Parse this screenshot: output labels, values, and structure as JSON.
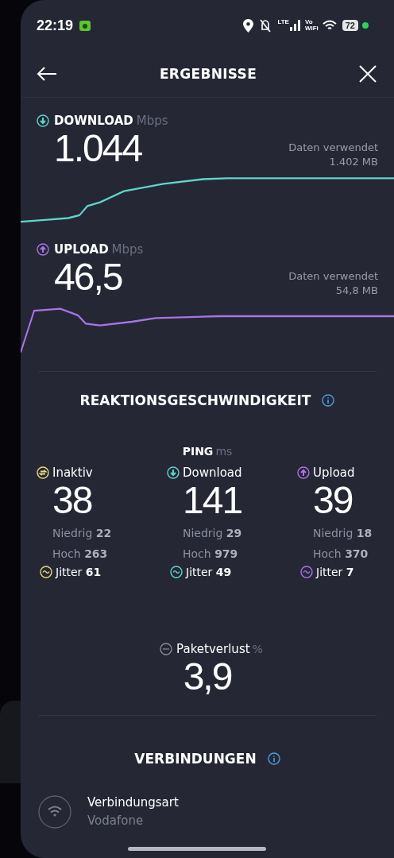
{
  "status_bar": {
    "time": "22:19",
    "network_label": "LTE",
    "calling_label_top": "Vo",
    "calling_label_bottom": "WiFi",
    "battery": "72"
  },
  "header": {
    "title": "ERGEBNISSE"
  },
  "speeds": [
    {
      "kind": "download",
      "label": "DOWNLOAD",
      "unit": "Mbps",
      "value": "1.044",
      "data_label": "Daten verwendet",
      "data_value": "1.402 MB",
      "color": "#5fd6cb"
    },
    {
      "kind": "upload",
      "label": "UPLOAD",
      "unit": "Mbps",
      "value": "46,5",
      "data_label": "Daten verwendet",
      "data_value": "54,8 MB",
      "color": "#a874e6"
    }
  ],
  "responsiveness": {
    "title": "REAKTIONSGESCHWINDIGKEIT",
    "ping_label": "PING",
    "ping_unit": "ms",
    "columns": [
      {
        "kind": "idle",
        "label": "Inaktiv",
        "value": "38",
        "low_label": "Niedrig",
        "low": "22",
        "high_label": "Hoch",
        "high": "263",
        "jitter_label": "Jitter",
        "jitter": "61",
        "color": "#e8d87c"
      },
      {
        "kind": "download",
        "label": "Download",
        "value": "141",
        "low_label": "Niedrig",
        "low": "29",
        "high_label": "Hoch",
        "high": "979",
        "jitter_label": "Jitter",
        "jitter": "49",
        "color": "#5fd6cb"
      },
      {
        "kind": "upload",
        "label": "Upload",
        "value": "39",
        "low_label": "Niedrig",
        "low": "18",
        "high_label": "Hoch",
        "high": "370",
        "jitter_label": "Jitter",
        "jitter": "7",
        "color": "#a874e6"
      }
    ],
    "packet_loss": {
      "label": "Paketverlust",
      "unit": "%",
      "value": "3,9"
    }
  },
  "connections": {
    "title": "VERBINDUNGEN",
    "items": [
      {
        "label": "Verbindungsart",
        "value": "Vodafone"
      }
    ]
  }
}
